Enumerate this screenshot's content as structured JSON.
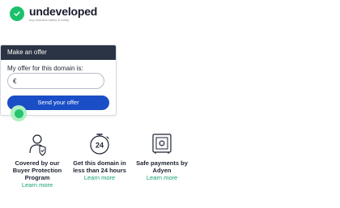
{
  "brand": {
    "name": "undeveloped",
    "tagline": "buy domains safely & easily",
    "accent": "#1bc06b"
  },
  "offer": {
    "header": "Make an offer",
    "label": "My offer for this domain is:",
    "currency": "€",
    "input_value": "",
    "input_placeholder": "",
    "button_label": "Send your offer",
    "button_color": "#1a4ec6"
  },
  "features": [
    {
      "icon": "shield-person-icon",
      "title_lines": [
        "Covered by our",
        "Buyer Protection",
        "Program"
      ],
      "link": "Learn more"
    },
    {
      "icon": "clock-24-icon",
      "title_lines": [
        "Get this domain in",
        "less than 24 hours"
      ],
      "link": "Learn more"
    },
    {
      "icon": "safe-icon",
      "title_lines": [
        "Safe payments by",
        "Adyen"
      ],
      "link": "Learn more"
    }
  ],
  "colors": {
    "link": "#14a06a",
    "header_bg": "#2b3444"
  }
}
